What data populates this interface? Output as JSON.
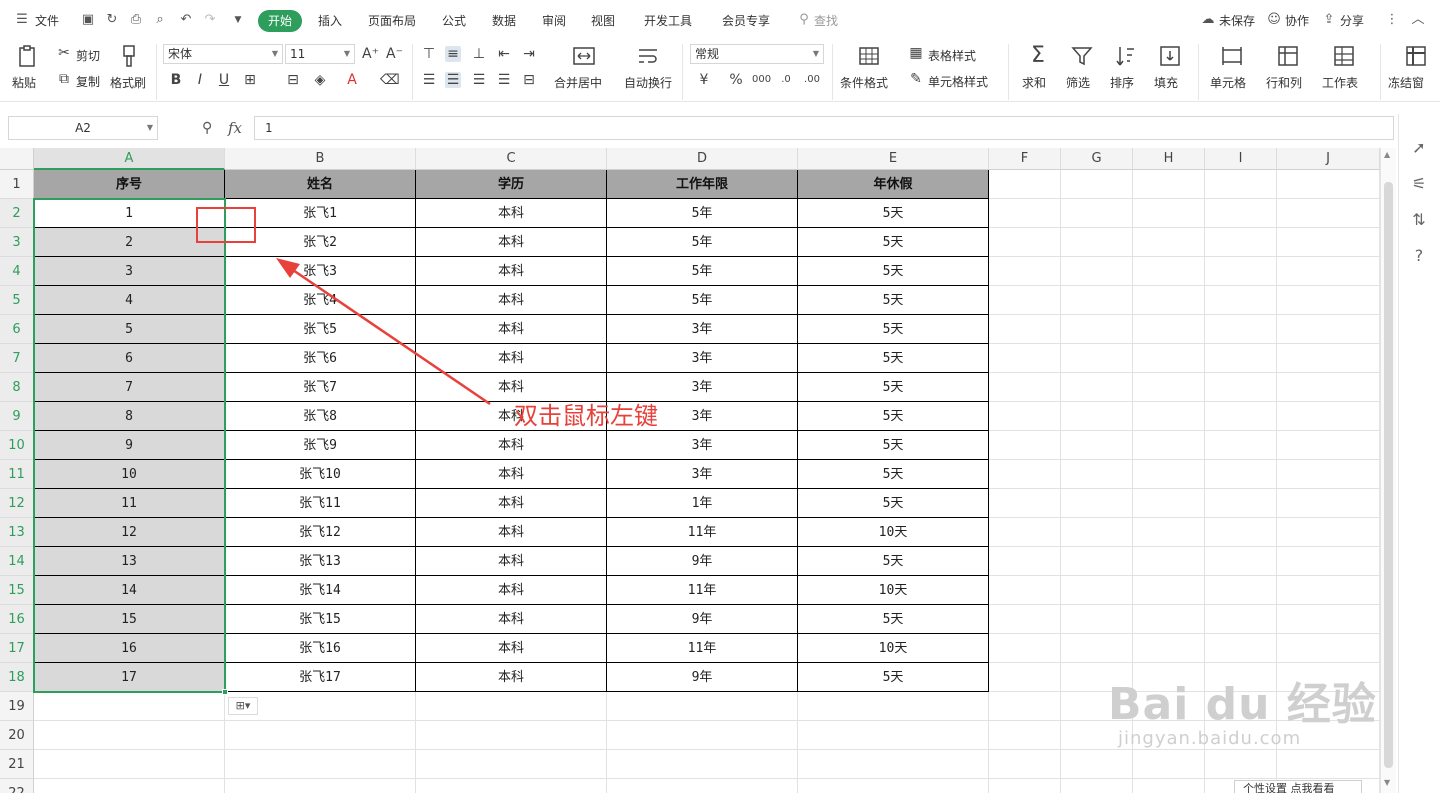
{
  "menu": {
    "file": "文件",
    "tabs": [
      "开始",
      "插入",
      "页面布局",
      "公式",
      "数据",
      "审阅",
      "视图",
      "开发工具",
      "会员专享"
    ],
    "search": "查找",
    "unsaved": "未保存",
    "collab": "协作",
    "share": "分享"
  },
  "ribbon": {
    "paste": "粘贴",
    "cut": "剪切",
    "copy": "复制",
    "format_painter": "格式刷",
    "font_name": "宋体",
    "font_size": "11",
    "merge_center": "合并居中",
    "wrap_text": "自动换行",
    "number_format": "常规",
    "table_style": "表格样式",
    "cond_format": "条件格式",
    "cell_style": "单元格样式",
    "sum": "求和",
    "filter": "筛选",
    "sort": "排序",
    "fill": "填充",
    "cell": "单元格",
    "row_col": "行和列",
    "worksheet": "工作表",
    "freeze": "冻结窗"
  },
  "formula": {
    "name_box": "A2",
    "fx": "fx",
    "value": "1"
  },
  "columns": [
    "A",
    "B",
    "C",
    "D",
    "E",
    "F",
    "G",
    "H",
    "I",
    "J"
  ],
  "rows": [
    "1",
    "2",
    "3",
    "4",
    "5",
    "6",
    "7",
    "8",
    "9",
    "10",
    "11",
    "12",
    "13",
    "14",
    "15",
    "16",
    "17",
    "18",
    "19",
    "20",
    "21",
    "22"
  ],
  "table": {
    "headers": [
      "序号",
      "姓名",
      "学历",
      "工作年限",
      "年休假"
    ],
    "data": [
      [
        "1",
        "张飞1",
        "本科",
        "5年",
        "5天"
      ],
      [
        "2",
        "张飞2",
        "本科",
        "5年",
        "5天"
      ],
      [
        "3",
        "张飞3",
        "本科",
        "5年",
        "5天"
      ],
      [
        "4",
        "张飞4",
        "本科",
        "5年",
        "5天"
      ],
      [
        "5",
        "张飞5",
        "本科",
        "3年",
        "5天"
      ],
      [
        "6",
        "张飞6",
        "本科",
        "3年",
        "5天"
      ],
      [
        "7",
        "张飞7",
        "本科",
        "3年",
        "5天"
      ],
      [
        "8",
        "张飞8",
        "本科",
        "3年",
        "5天"
      ],
      [
        "9",
        "张飞9",
        "本科",
        "3年",
        "5天"
      ],
      [
        "10",
        "张飞10",
        "本科",
        "3年",
        "5天"
      ],
      [
        "11",
        "张飞11",
        "本科",
        "1年",
        "5天"
      ],
      [
        "12",
        "张飞12",
        "本科",
        "11年",
        "10天"
      ],
      [
        "13",
        "张飞13",
        "本科",
        "9年",
        "5天"
      ],
      [
        "14",
        "张飞14",
        "本科",
        "11年",
        "10天"
      ],
      [
        "15",
        "张飞15",
        "本科",
        "9年",
        "5天"
      ],
      [
        "16",
        "张飞16",
        "本科",
        "11年",
        "10天"
      ],
      [
        "17",
        "张飞17",
        "本科",
        "9年",
        "5天"
      ]
    ]
  },
  "annotation": "双击鼠标左键",
  "watermark": {
    "logo": "Bai du 经验",
    "url": "jingyan.baidu.com"
  },
  "bottom_popup": "个性设置  点我看看",
  "colors": {
    "accent": "#2d9e5b",
    "header_fill": "#a6a6a6",
    "selection_fill": "#d9d9d9",
    "annotation": "#e8403a"
  }
}
